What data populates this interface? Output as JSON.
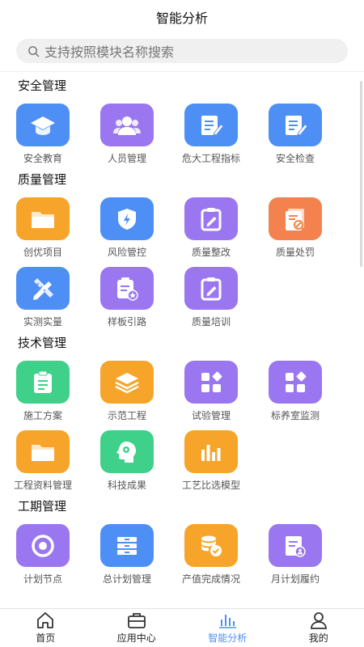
{
  "header": {
    "title": "智能分析"
  },
  "search": {
    "placeholder": "支持按照模块名称搜索"
  },
  "sections": [
    {
      "title": "安全管理",
      "items": [
        {
          "label": "安全教育",
          "icon": "graduation-cap-icon",
          "color": "#4e8ff5"
        },
        {
          "label": "人员管理",
          "icon": "people-icon",
          "color": "#9a77f0"
        },
        {
          "label": "危大工程指标",
          "icon": "edit-document-icon",
          "color": "#4e8ff5"
        },
        {
          "label": "安全检查",
          "icon": "edit-document-icon",
          "color": "#4e8ff5"
        }
      ]
    },
    {
      "title": "质量管理",
      "items": [
        {
          "label": "创优项目",
          "icon": "folder-icon",
          "color": "#f7a52a"
        },
        {
          "label": "风险管控",
          "icon": "shield-bolt-icon",
          "color": "#4e8ff5"
        },
        {
          "label": "质量整改",
          "icon": "clipboard-edit-icon",
          "color": "#9a77f0"
        },
        {
          "label": "质量处罚",
          "icon": "document-ban-icon",
          "color": "#f3824f"
        },
        {
          "label": "实测实量",
          "icon": "ruler-pencil-icon",
          "color": "#4e8ff5"
        },
        {
          "label": "样板引路",
          "icon": "clipboard-star-icon",
          "color": "#9a77f0"
        },
        {
          "label": "质量培训",
          "icon": "clipboard-edit-icon",
          "color": "#9a77f0"
        }
      ]
    },
    {
      "title": "技术管理",
      "items": [
        {
          "label": "施工方案",
          "icon": "clipboard-list-icon",
          "color": "#3fd08a"
        },
        {
          "label": "示范工程",
          "icon": "layers-icon",
          "color": "#f7a52a"
        },
        {
          "label": "试验管理",
          "icon": "apps-icon",
          "color": "#9a77f0"
        },
        {
          "label": "标养室监测",
          "icon": "apps-icon",
          "color": "#9a77f0"
        },
        {
          "label": "工程资料管理",
          "icon": "folder-icon",
          "color": "#f7a52a"
        },
        {
          "label": "科技成果",
          "icon": "head-gear-icon",
          "color": "#3fd08a"
        },
        {
          "label": "工艺比选模型",
          "icon": "bar-chart-icon",
          "color": "#f7a52a"
        }
      ]
    },
    {
      "title": "工期管理",
      "items": [
        {
          "label": "计划节点",
          "icon": "circle-target-icon",
          "color": "#9a77f0"
        },
        {
          "label": "总计划管理",
          "icon": "database-icon",
          "color": "#4e8ff5"
        },
        {
          "label": "产值完成情况",
          "icon": "coins-check-icon",
          "color": "#f7a52a"
        },
        {
          "label": "月计划履约",
          "icon": "document-user-icon",
          "color": "#9a77f0"
        }
      ]
    }
  ],
  "tabbar": {
    "items": [
      {
        "label": "首页",
        "icon": "home-icon",
        "active": false
      },
      {
        "label": "应用中心",
        "icon": "briefcase-icon",
        "active": false
      },
      {
        "label": "智能分析",
        "icon": "bar-chart-icon",
        "active": true
      },
      {
        "label": "我的",
        "icon": "user-icon",
        "active": false
      }
    ],
    "active_color": "#4e8ff5"
  }
}
